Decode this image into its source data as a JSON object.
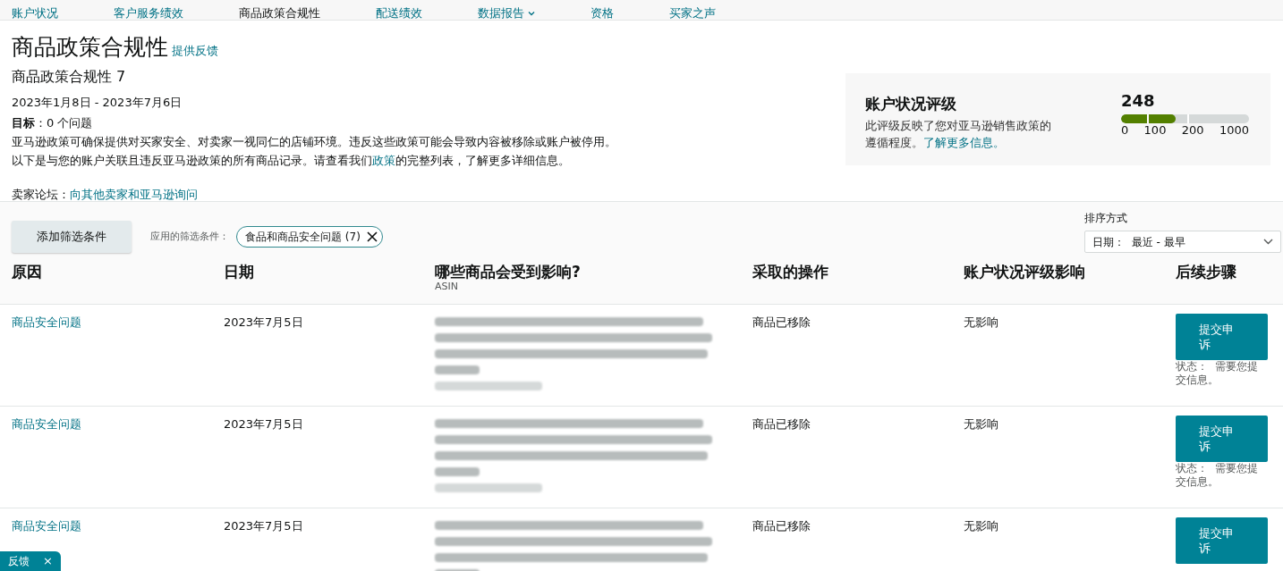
{
  "nav_tabs": [
    {
      "label": "账户状况",
      "selected": false,
      "dropdown": false
    },
    {
      "label": "客户服务绩效",
      "selected": false,
      "dropdown": false
    },
    {
      "label": "商品政策合规性",
      "selected": true,
      "dropdown": false
    },
    {
      "label": "配送绩效",
      "selected": false,
      "dropdown": false
    },
    {
      "label": "数据报告",
      "selected": false,
      "dropdown": true
    },
    {
      "label": "资格",
      "selected": false,
      "dropdown": false
    },
    {
      "label": "买家之声",
      "selected": false,
      "dropdown": false
    }
  ],
  "header": {
    "title": "商品政策合规性",
    "feedback_link": "提供反馈",
    "subtitle": "商品政策合规性 7",
    "date_range": "2023年1月8日 - 2023年7月6日",
    "target_label": "目标",
    "target_value": "：0 个问题",
    "description_1": "亚马逊政策可确保提供对买家安全、对卖家一视同仁的店铺环境。违反这些政策可能会导致内容被移除或账户被停用。",
    "description_2_before": "以下是与您的账户关联且违反亚马逊政策的所有商品记录。请查看我们",
    "description_2_link": "政策",
    "description_2_after": "的完整列表，了解更多详细信息。",
    "forum_label": "卖家论坛：",
    "forum_link": "向其他卖家和亚马逊询问"
  },
  "rating_card": {
    "title": "账户状况评级",
    "description": "此评级反映了您对亚马逊销售政策的遵循程度。",
    "learn_more": "了解更多信息。",
    "score": "248",
    "level": 0.43,
    "ticks": [
      "0",
      "100",
      "200",
      "1000"
    ]
  },
  "filters": {
    "add_button": "添加筛选条件",
    "applied_label": "应用的筛选条件：",
    "chips": [
      "食品和商品安全问题 (7)"
    ],
    "sort_label": "排序方式",
    "sort_value": "日期：  最近 - 最早"
  },
  "table": {
    "columns": [
      {
        "label": "原因"
      },
      {
        "label": "日期"
      },
      {
        "label": "哪些商品会受到影响?",
        "sublabel": "ASIN"
      },
      {
        "label": "采取的操作"
      },
      {
        "label": "账户状况评级影响"
      },
      {
        "label": "后续步骤"
      }
    ],
    "rows": [
      {
        "reason": "商品安全问题",
        "date": "2023年7月5日",
        "action": "商品已移除",
        "impact": "无影响",
        "button": "提交申诉",
        "status": "状态：  需要您提交信息。"
      },
      {
        "reason": "商品安全问题",
        "date": "2023年7月5日",
        "action": "商品已移除",
        "impact": "无影响",
        "button": "提交申诉",
        "status": "状态：  需要您提交信息。"
      },
      {
        "reason": "商品安全问题",
        "date": "2023年7月5日",
        "action": "商品已移除",
        "impact": "无影响",
        "button": "提交申诉"
      }
    ]
  },
  "feedback_tab": {
    "label": "反馈",
    "close": "×"
  }
}
